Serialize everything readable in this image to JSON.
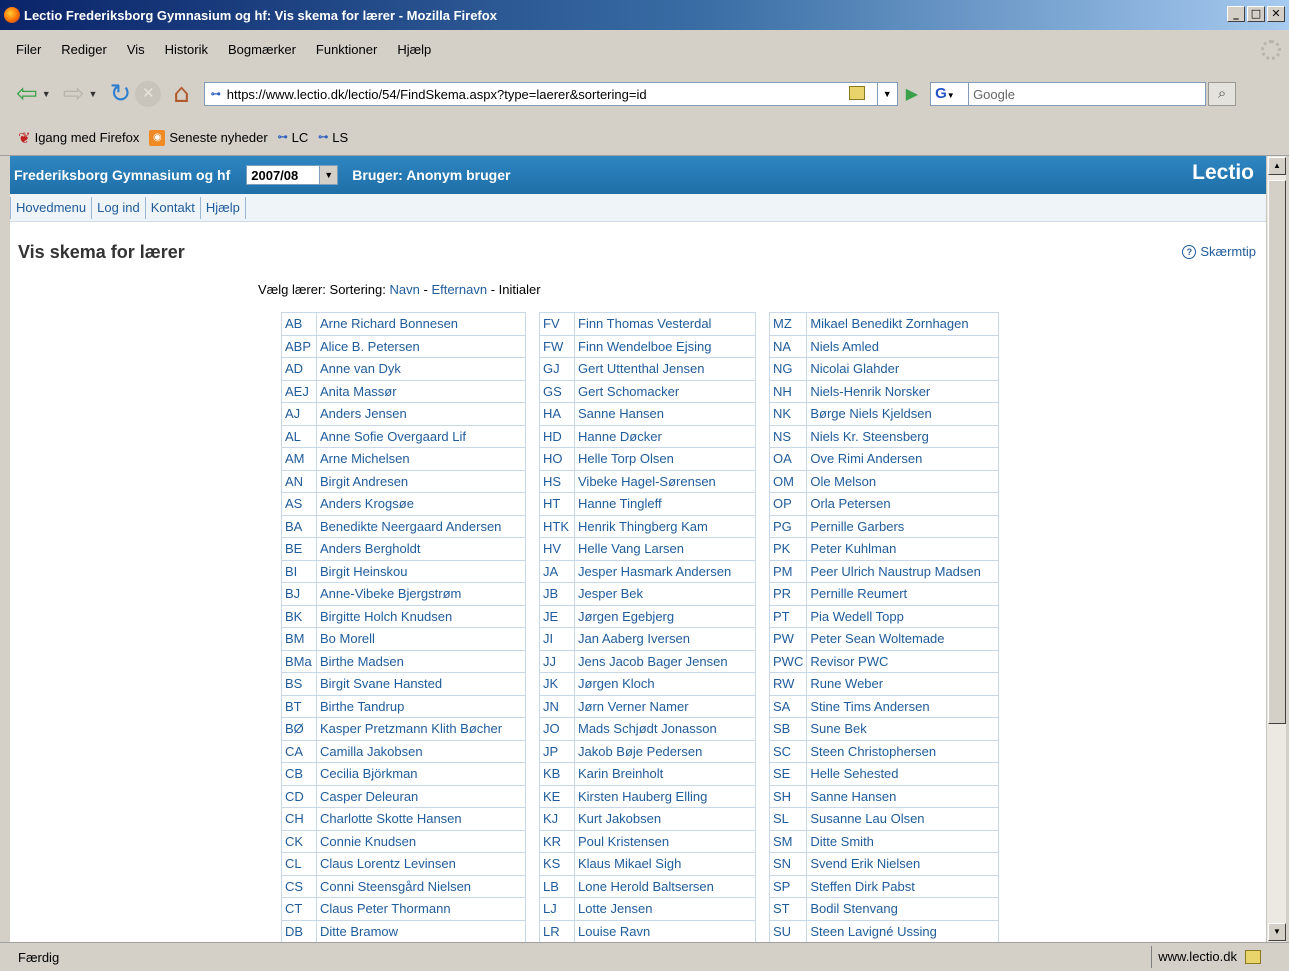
{
  "window": {
    "title": "Lectio Frederiksborg Gymnasium og hf: Vis skema for lærer - Mozilla Firefox",
    "minimize": "_",
    "maximize": "□",
    "close": "✕"
  },
  "menu": [
    "Filer",
    "Rediger",
    "Vis",
    "Historik",
    "Bogmærker",
    "Funktioner",
    "Hjælp"
  ],
  "navbar": {
    "url": "https://www.lectio.dk/lectio/54/FindSkema.aspx?type=laerer&sortering=id",
    "search_placeholder": "Google",
    "search_engine": "G"
  },
  "bookmarks": [
    "Igang med Firefox",
    "Seneste nyheder",
    "LC",
    "LS"
  ],
  "lectio": {
    "school": "Frederiksborg Gymnasium og hf",
    "year": "2007/08",
    "user": "Bruger: Anonym bruger",
    "brand": "Lectio",
    "nav": [
      "Hovedmenu",
      "Log ind",
      "Kontakt",
      "Hjælp"
    ],
    "page_title": "Vis skema for lærer",
    "tip": "Skærmtip",
    "sort_prefix": "Vælg lærer: Sortering:",
    "sort_name": "Navn",
    "sort_sep1": " - ",
    "sort_lastname": "Efternavn",
    "sort_sep2": " - ",
    "sort_initials": "Initialer"
  },
  "teachers": {
    "col1": [
      [
        "AB",
        "Arne Richard Bonnesen"
      ],
      [
        "ABP",
        "Alice B. Petersen"
      ],
      [
        "AD",
        "Anne van Dyk"
      ],
      [
        "AEJ",
        "Anita Massør"
      ],
      [
        "AJ",
        "Anders Jensen"
      ],
      [
        "AL",
        "Anne Sofie Overgaard Lif"
      ],
      [
        "AM",
        "Arne Michelsen"
      ],
      [
        "AN",
        "Birgit Andresen"
      ],
      [
        "AS",
        "Anders Krogsøe"
      ],
      [
        "BA",
        "Benedikte Neergaard Andersen"
      ],
      [
        "BE",
        "Anders Bergholdt"
      ],
      [
        "BI",
        "Birgit Heinskou"
      ],
      [
        "BJ",
        "Anne-Vibeke Bjergstrøm"
      ],
      [
        "BK",
        "Birgitte Holch Knudsen"
      ],
      [
        "BM",
        "Bo Morell"
      ],
      [
        "BMa",
        "Birthe Madsen"
      ],
      [
        "BS",
        "Birgit Svane Hansted"
      ],
      [
        "BT",
        "Birthe Tandrup"
      ],
      [
        "BØ",
        "Kasper Pretzmann Klith Bøcher"
      ],
      [
        "CA",
        "Camilla Jakobsen"
      ],
      [
        "CB",
        "Cecilia Björkman"
      ],
      [
        "CD",
        "Casper Deleuran"
      ],
      [
        "CH",
        "Charlotte Skotte Hansen"
      ],
      [
        "CK",
        "Connie Knudsen"
      ],
      [
        "CL",
        "Claus Lorentz Levinsen"
      ],
      [
        "CS",
        "Conni Steensgård Nielsen"
      ],
      [
        "CT",
        "Claus Peter Thormann"
      ],
      [
        "DB",
        "Ditte Bramow"
      ]
    ],
    "col2": [
      [
        "FV",
        "Finn Thomas Vesterdal"
      ],
      [
        "FW",
        "Finn Wendelboe Ejsing"
      ],
      [
        "GJ",
        "Gert Uttenthal Jensen"
      ],
      [
        "GS",
        "Gert Schomacker"
      ],
      [
        "HA",
        "Sanne Hansen"
      ],
      [
        "HD",
        "Hanne Døcker"
      ],
      [
        "HO",
        "Helle Torp Olsen"
      ],
      [
        "HS",
        "Vibeke Hagel-Sørensen"
      ],
      [
        "HT",
        "Hanne Tingleff"
      ],
      [
        "HTK",
        "Henrik Thingberg Kam"
      ],
      [
        "HV",
        "Helle Vang Larsen"
      ],
      [
        "JA",
        "Jesper Hasmark Andersen"
      ],
      [
        "JB",
        "Jesper Bek"
      ],
      [
        "JE",
        "Jørgen Egebjerg"
      ],
      [
        "JI",
        "Jan Aaberg Iversen"
      ],
      [
        "JJ",
        "Jens Jacob Bager Jensen"
      ],
      [
        "JK",
        "Jørgen Kloch"
      ],
      [
        "JN",
        "Jørn Verner Namer"
      ],
      [
        "JO",
        "Mads Schjødt Jonasson"
      ],
      [
        "JP",
        "Jakob Bøje Pedersen"
      ],
      [
        "KB",
        "Karin Breinholt"
      ],
      [
        "KE",
        "Kirsten Hauberg Elling"
      ],
      [
        "KJ",
        "Kurt Jakobsen"
      ],
      [
        "KR",
        "Poul Kristensen"
      ],
      [
        "KS",
        "Klaus Mikael Sigh"
      ],
      [
        "LB",
        "Lone Herold Baltsersen"
      ],
      [
        "LJ",
        "Lotte Jensen"
      ],
      [
        "LR",
        "Louise Ravn"
      ]
    ],
    "col3": [
      [
        "MZ",
        "Mikael Benedikt Zornhagen"
      ],
      [
        "NA",
        "Niels Amled"
      ],
      [
        "NG",
        "Nicolai Glahder"
      ],
      [
        "NH",
        "Niels-Henrik Norsker"
      ],
      [
        "NK",
        "Børge Niels Kjeldsen"
      ],
      [
        "NS",
        "Niels Kr. Steensberg"
      ],
      [
        "OA",
        "Ove Rimi Andersen"
      ],
      [
        "OM",
        "Ole Melson"
      ],
      [
        "OP",
        "Orla Petersen"
      ],
      [
        "PG",
        "Pernille Garbers"
      ],
      [
        "PK",
        "Peter Kuhlman"
      ],
      [
        "PM",
        "Peer Ulrich Naustrup Madsen"
      ],
      [
        "PR",
        "Pernille Reumert"
      ],
      [
        "PT",
        "Pia Wedell Topp"
      ],
      [
        "PW",
        "Peter Sean Woltemade"
      ],
      [
        "PWC",
        "Revisor PWC"
      ],
      [
        "RW",
        "Rune Weber"
      ],
      [
        "SA",
        "Stine Tims Andersen"
      ],
      [
        "SB",
        "Sune Bek"
      ],
      [
        "SC",
        "Steen Christophersen"
      ],
      [
        "SE",
        "Helle Sehested"
      ],
      [
        "SH",
        "Sanne Hansen"
      ],
      [
        "SL",
        "Susanne Lau Olsen"
      ],
      [
        "SM",
        "Ditte Smith"
      ],
      [
        "SN",
        "Svend Erik Nielsen"
      ],
      [
        "SP",
        "Steffen Dirk Pabst"
      ],
      [
        "ST",
        "Bodil Stenvang"
      ],
      [
        "SU",
        "Steen Lavigné Ussing"
      ]
    ]
  },
  "status": {
    "message": "Færdig",
    "host": "www.lectio.dk"
  }
}
